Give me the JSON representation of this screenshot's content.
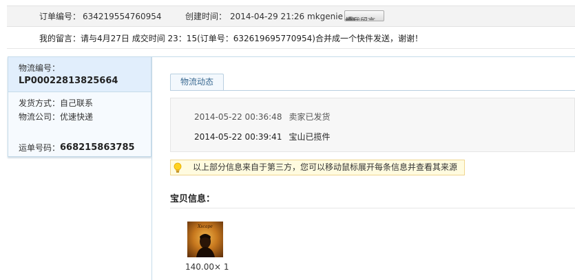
{
  "order_bar": {
    "order_no_label": "订单编号：",
    "order_no": "634219554760954",
    "created_label": "创建时间：",
    "created_time": "2014-04-29 21:26",
    "seller": "mkgenie",
    "message_button": "给我留言",
    "message_icon": "chat-bubble-icon"
  },
  "buyer_message": {
    "label": "我的留言：",
    "text": "请与4月27日 成交时间 23：15(订单号：632619695770954)合并成一个快件发送，谢谢！"
  },
  "logistics": {
    "logistics_no_label": "物流编号：",
    "logistics_no": "LP00022813825664",
    "ship_method": "发货方式：自己联系",
    "company": "物流公司：优速快递",
    "waybill_label": "运单号码：",
    "waybill_no": "668215863785"
  },
  "tracking": {
    "tab_label": "物流动态",
    "events": [
      {
        "time": "2014-05-22 00:36:48",
        "text": "卖家已发货"
      },
      {
        "time": "2014-05-22 00:39:41",
        "text": "宝山已揽件"
      }
    ]
  },
  "notice": {
    "icon": "lightbulb-icon",
    "text": "以上部分信息来自于第三方，您可以移动鼠标展开每条信息并查看其来源"
  },
  "product": {
    "section_title": "宝贝信息：",
    "price_qty": "140.00× 1",
    "thumb_caption": "Xscape"
  },
  "colors": {
    "side_panel_top": "#e1eefc",
    "side_panel_border": "#c5dbea",
    "notice_bg": "#fffbdf",
    "notice_border": "#f0d58e",
    "tab_text": "#3b6a92"
  }
}
